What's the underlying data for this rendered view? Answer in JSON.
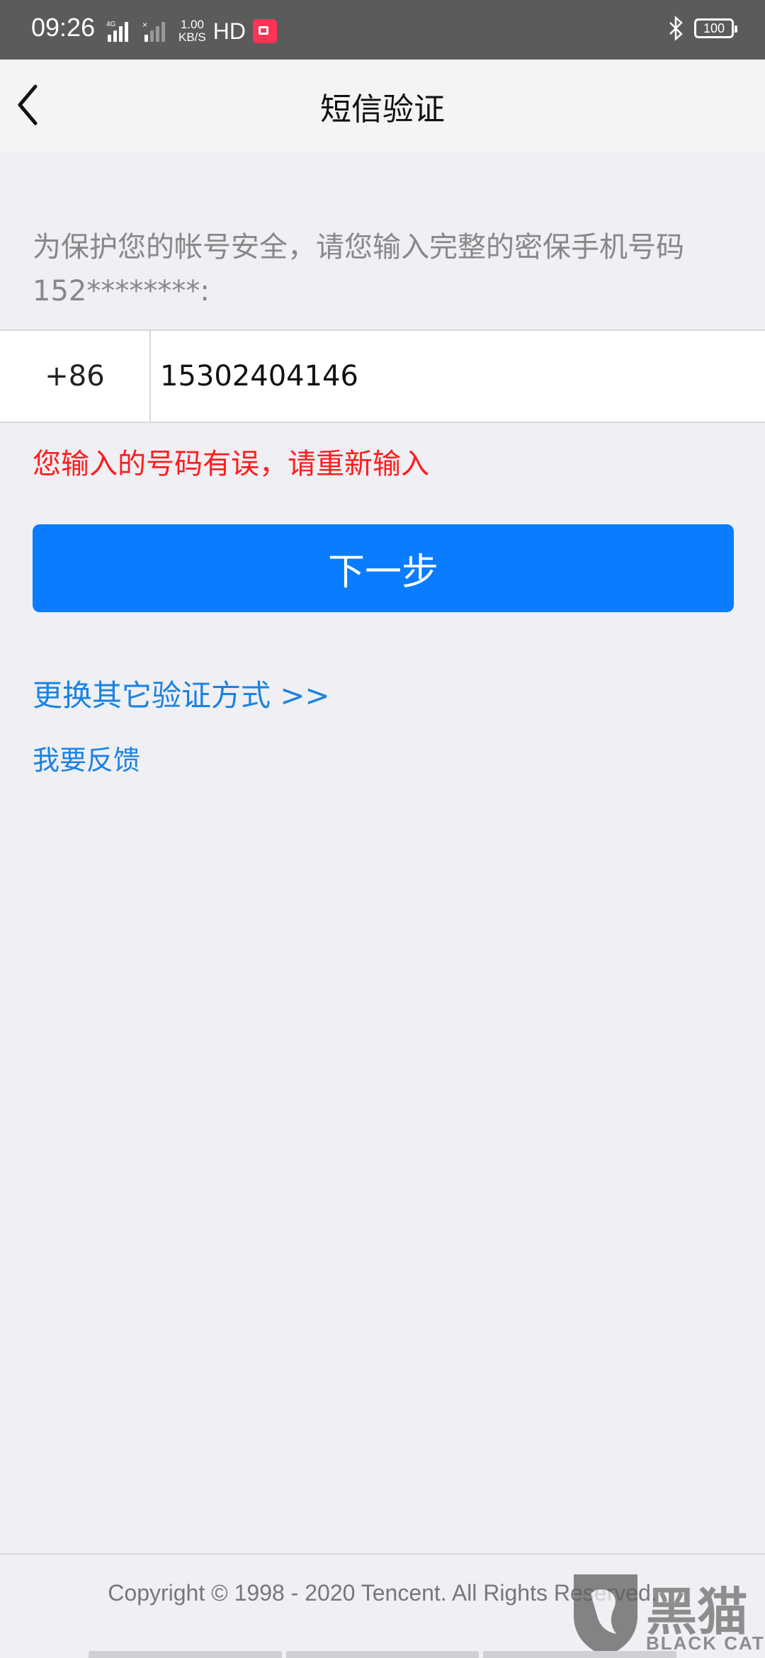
{
  "status_bar": {
    "time": "09:26",
    "network_label": "4G",
    "speed_value": "1.00",
    "speed_unit": "KB/S",
    "hd_label": "HD",
    "battery_level": "100"
  },
  "header": {
    "title": "短信验证"
  },
  "prompt_text": "为保护您的帐号安全，请您输入完整的密保手机号码152********:",
  "phone": {
    "country_code": "+86",
    "value": "15302404146"
  },
  "error_text": "您输入的号码有误，请重新输入",
  "next_button_label": "下一步",
  "alt_verify_link": "更换其它验证方式 >>",
  "feedback_link": "我要反馈",
  "copyright": "Copyright © 1998 - 2020 Tencent. All Rights Reserved.",
  "watermark": {
    "cn": "黑猫",
    "en": "BLACK CAT"
  },
  "colors": {
    "primary": "#0a7cff",
    "link": "#1a82e2",
    "error": "#ff1d1d",
    "background": "#efeff4"
  }
}
